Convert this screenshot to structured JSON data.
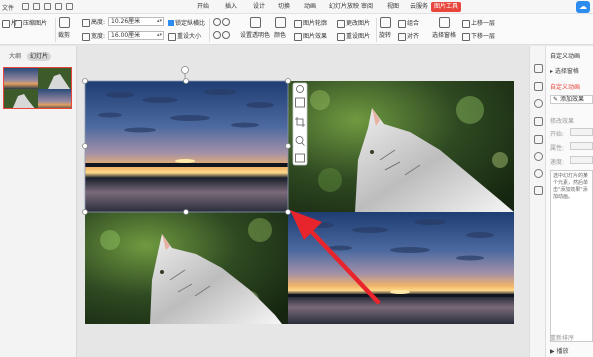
{
  "menubar": {
    "file_label": "文件",
    "tabs": [
      {
        "label": "开始",
        "active": false
      },
      {
        "label": "插入",
        "active": false
      },
      {
        "label": "设计",
        "active": false
      },
      {
        "label": "切换",
        "active": false
      },
      {
        "label": "动画",
        "active": false
      },
      {
        "label": "幻灯片放映",
        "active": false
      },
      {
        "label": "审阅",
        "active": false
      },
      {
        "label": "视图",
        "active": false
      },
      {
        "label": "云服务",
        "active": false
      },
      {
        "label": "图片工具",
        "active": true
      }
    ]
  },
  "toolbar": {
    "add_picture": "片",
    "compress": "压缩图片",
    "crop": "裁剪",
    "height_label": "高度:",
    "height_value": "10.26厘米",
    "width_label": "宽度:",
    "width_value": "16.00厘米",
    "lock_ratio": "锁定纵横比",
    "reset_size": "重设大小",
    "transparent": "设置透明色",
    "color": "颜色",
    "outline": "图片轮廓",
    "effect": "图片效果",
    "change_pic": "更改图片",
    "reset_pic": "重设图片",
    "rotate": "旋转",
    "group": "组合",
    "align": "对齐",
    "select_pane": "选择窗格",
    "bring_forward": "上移一层",
    "send_backward": "下移一层"
  },
  "leftpanel": {
    "tab_outline": "大纲",
    "tab_slides": "幻灯片",
    "slide_number": "1"
  },
  "rightpanel": {
    "title": "自定义动画",
    "select_pane": "选择窗格",
    "section_title": "自定义动画",
    "add_effect": "添加效果",
    "modify_effect": "修改效果",
    "start_label": "开始:",
    "property_label": "属性:",
    "speed_label": "速度:",
    "hint": "选中幻灯片的某个元素，然后单击\"添加效果\"添加动画。",
    "reorder": "重新排序",
    "play": "播放"
  },
  "colors": {
    "accent": "#e8453c",
    "arrow": "#e8242c"
  }
}
